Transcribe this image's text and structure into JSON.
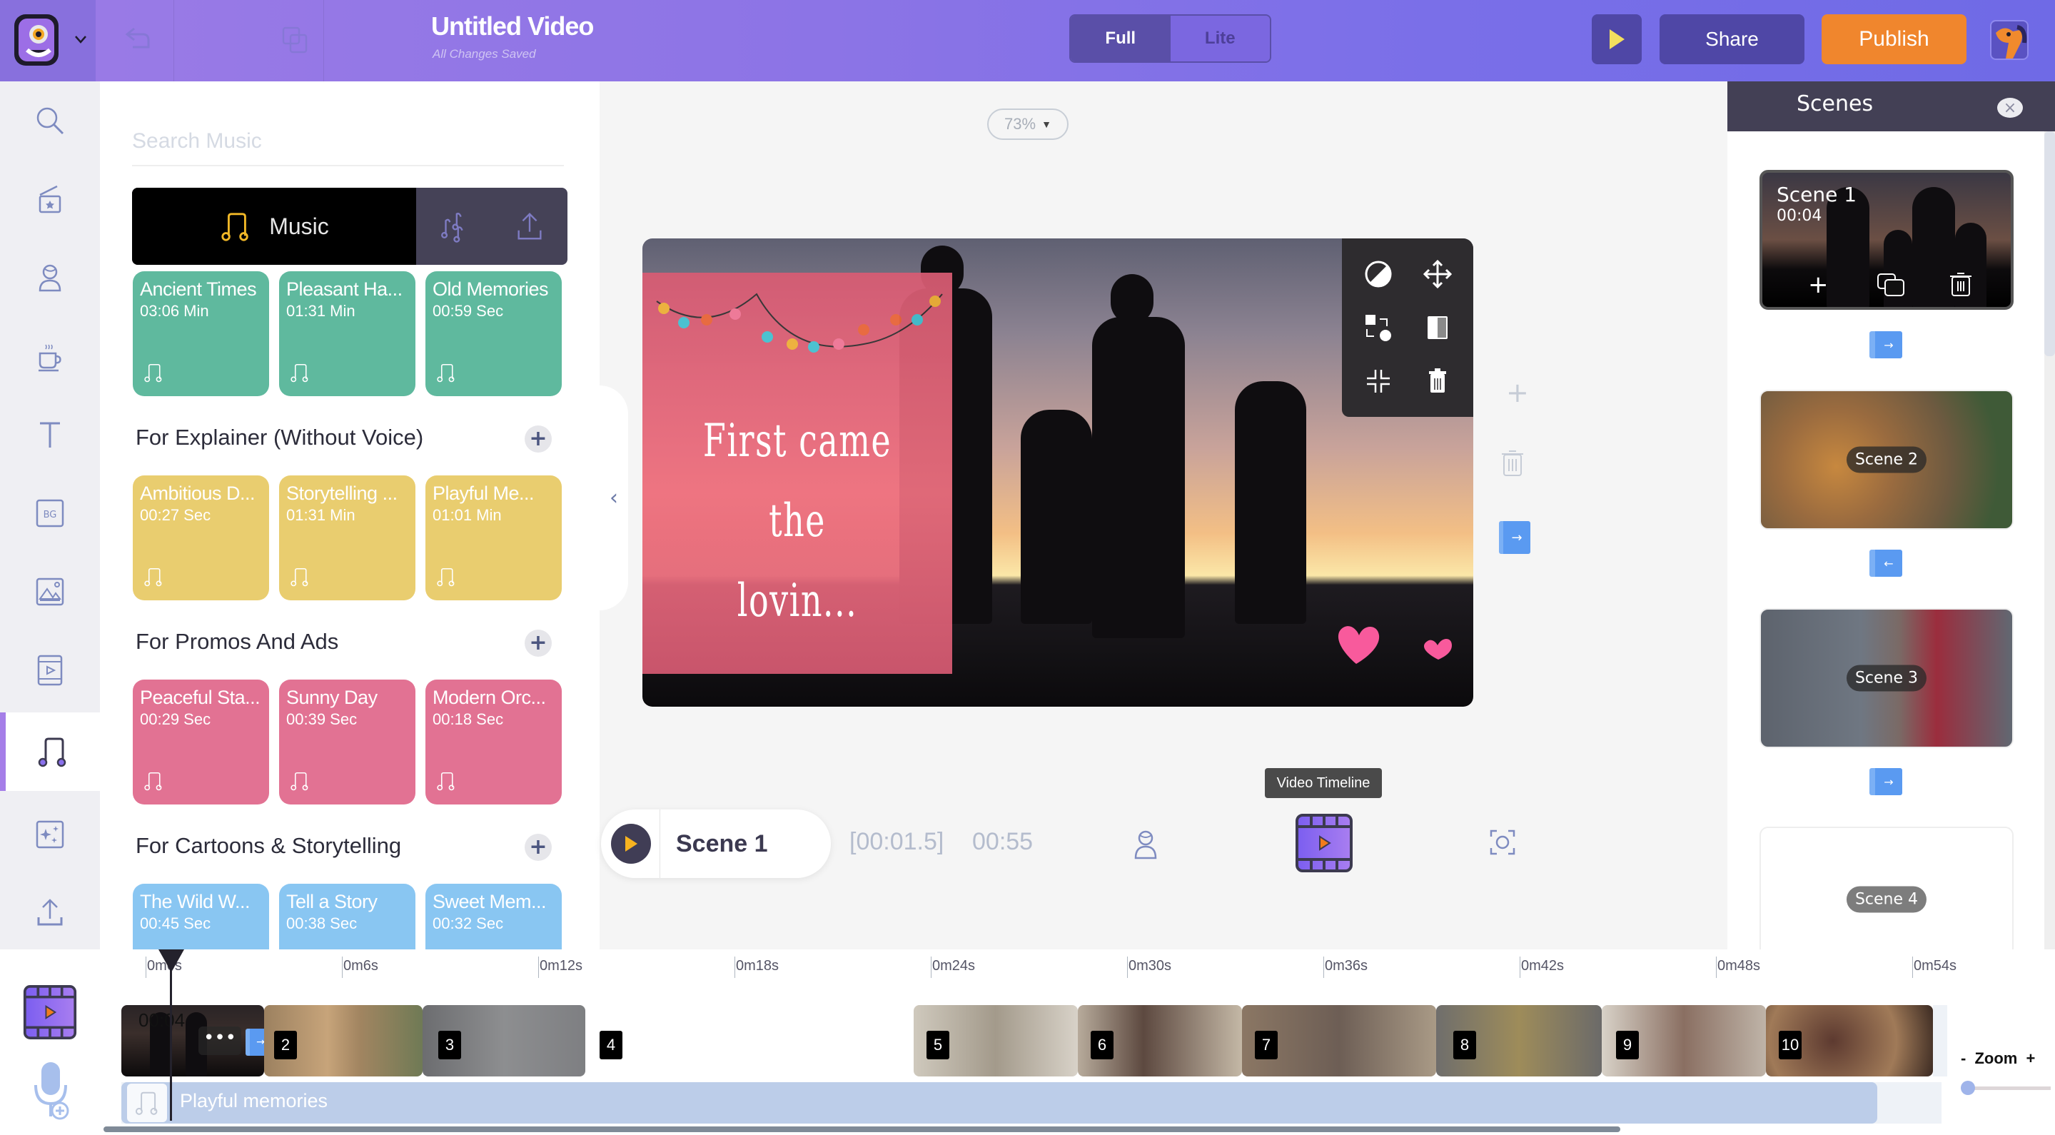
{
  "header": {
    "title": "Untitled Video",
    "save_status": "All Changes Saved",
    "mode_options": [
      "Full",
      "Lite"
    ],
    "mode_selected": "Full",
    "share_label": "Share",
    "publish_label": "Publish",
    "icons": [
      "app-logo-icon",
      "chevron-down-icon",
      "undo-icon",
      "duplicate-icon",
      "play-preview-icon",
      "user-avatar"
    ]
  },
  "rail": {
    "items": [
      {
        "icon": "search-icon"
      },
      {
        "icon": "clapper-star-icon"
      },
      {
        "icon": "character-icon"
      },
      {
        "icon": "coffee-cup-icon"
      },
      {
        "icon": "text-icon"
      },
      {
        "icon": "background-icon",
        "label": "BG"
      },
      {
        "icon": "image-icon"
      },
      {
        "icon": "video-icon"
      },
      {
        "icon": "music-icon",
        "active": true
      },
      {
        "icon": "effects-icon"
      },
      {
        "icon": "upload-icon"
      }
    ]
  },
  "music": {
    "search_placeholder": "Search Music",
    "search_value": "",
    "tabs": [
      {
        "label": "Music",
        "icon": "music-note-icon",
        "active": true
      },
      {
        "icon": "sound-effects-icon"
      },
      {
        "icon": "upload-icon"
      }
    ],
    "sections": [
      {
        "title": "",
        "color": "#5fb99e",
        "tracks": [
          {
            "title": "Ancient Times",
            "duration": "03:06 Min"
          },
          {
            "title": "Pleasant Ha...",
            "duration": "01:31 Min"
          },
          {
            "title": "Old Memories",
            "duration": "00:59 Sec"
          }
        ]
      },
      {
        "title": "For Explainer (Without Voice)",
        "color": "#e9cd6f",
        "tracks": [
          {
            "title": "Ambitious D...",
            "duration": "00:27 Sec"
          },
          {
            "title": "Storytelling ...",
            "duration": "01:31 Min"
          },
          {
            "title": "Playful Me...",
            "duration": "01:01 Min"
          }
        ]
      },
      {
        "title": "For Promos And Ads",
        "color": "#e27293",
        "tracks": [
          {
            "title": "Peaceful Sta...",
            "duration": "00:29 Sec"
          },
          {
            "title": "Sunny Day",
            "duration": "00:39 Sec"
          },
          {
            "title": "Modern Orc...",
            "duration": "00:18 Sec"
          }
        ]
      },
      {
        "title": "For Cartoons & Storytelling",
        "color": "#89c6f2",
        "tracks": [
          {
            "title": "The Wild W...",
            "duration": "00:45 Sec"
          },
          {
            "title": "Tell a Story",
            "duration": "00:38 Sec"
          },
          {
            "title": "Sweet Mem...",
            "duration": "00:32 Sec"
          }
        ]
      }
    ],
    "add_label": "+"
  },
  "canvas": {
    "zoom": "73%",
    "headline_lines": [
      "First came",
      "the",
      "lovin..."
    ],
    "image_toolbar": [
      "filter-icon",
      "move-icon",
      "swap-icon",
      "opacity-icon",
      "fit-icon",
      "delete-icon"
    ],
    "side_add": "+"
  },
  "player": {
    "scene_name": "Scene 1",
    "current_time": "[00:01.5]",
    "total_time": "00:55",
    "tooltip": "Video Timeline"
  },
  "scenes": {
    "title": "Scenes",
    "close": "×",
    "list": [
      {
        "name": "Scene 1",
        "duration": "00:04",
        "selected": true
      },
      {
        "name": "Scene 2"
      },
      {
        "name": "Scene 3"
      },
      {
        "name": "Scene 4"
      }
    ],
    "transitions": [
      "→",
      "←",
      "→"
    ]
  },
  "timeline": {
    "ticks": [
      "0m0s",
      "0m6s",
      "0m12s",
      "0m18s",
      "0m24s",
      "0m30s",
      "0m36s",
      "0m42s",
      "0m48s",
      "0m54s"
    ],
    "first_clip_time": "00:04",
    "clip_numbers": [
      "2",
      "3",
      "4",
      "5",
      "6",
      "7",
      "8",
      "9",
      "10"
    ],
    "audio_track": "Playful memories",
    "zoom_minus": "-",
    "zoom_label": "Zoom",
    "zoom_plus": "+",
    "zoom_level": 0
  }
}
